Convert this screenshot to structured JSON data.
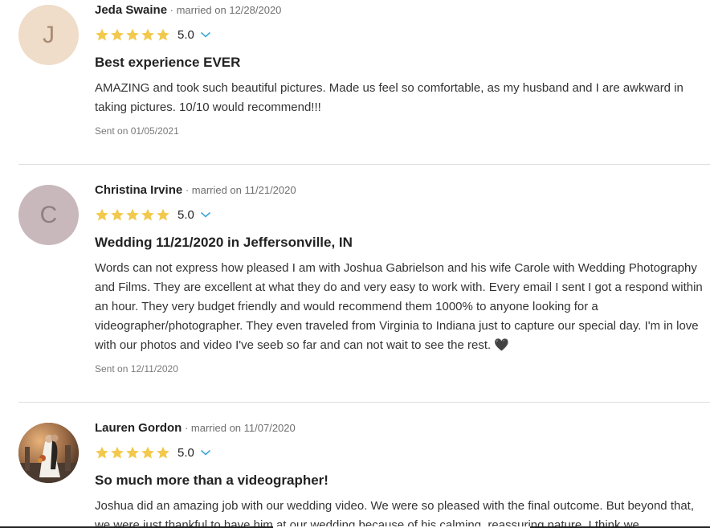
{
  "colors": {
    "star": "#f2c94c",
    "chevron": "#3aa8d8",
    "avatar_j": "#efdcc9",
    "avatar_j_text": "#a88b73",
    "avatar_c": "#c8b8bc",
    "avatar_c_text": "#8f7f84"
  },
  "reviews": [
    {
      "initial": "J",
      "name": "Jeda Swaine",
      "married": " · married on 12/28/2020",
      "rating": "5.0",
      "stars": 5,
      "title": "Best experience EVER",
      "body": "AMAZING and took such beautiful pictures. Made us feel so comfortable, as my husband and I are awkward in taking pictures. 10/10 would recommend!!!",
      "sent": "Sent on 01/05/2021"
    },
    {
      "initial": "C",
      "name": "Christina Irvine",
      "married": " · married on 11/21/2020",
      "rating": "5.0",
      "stars": 5,
      "title": "Wedding 11/21/2020 in Jeffersonville, IN",
      "body": "Words can not express how pleased I am with Joshua Gabrielson and his wife Carole with Wedding Photography and Films. They are excellent at what they do and very easy to work with. Every email I sent I got a respond within an hour. They very budget friendly and would recommend them 1000% to anyone looking for a videographer/photographer. They even traveled from Virginia to Indiana just to capture our special day. I'm in love with our photos and video I've seeb so far and can not wait to see the rest. 🖤",
      "sent": "Sent on 12/11/2020"
    },
    {
      "initial": "",
      "name": "Lauren Gordon",
      "married": " · married on 11/07/2020",
      "rating": "5.0",
      "stars": 5,
      "title": "So much more than a videographer!",
      "body": "Joshua did an amazing job with our wedding video. We were so pleased with the final outcome. But beyond that, we were just thankful to have him at our wedding because of his calming, reassuring nature. I think we",
      "sent": ""
    }
  ]
}
